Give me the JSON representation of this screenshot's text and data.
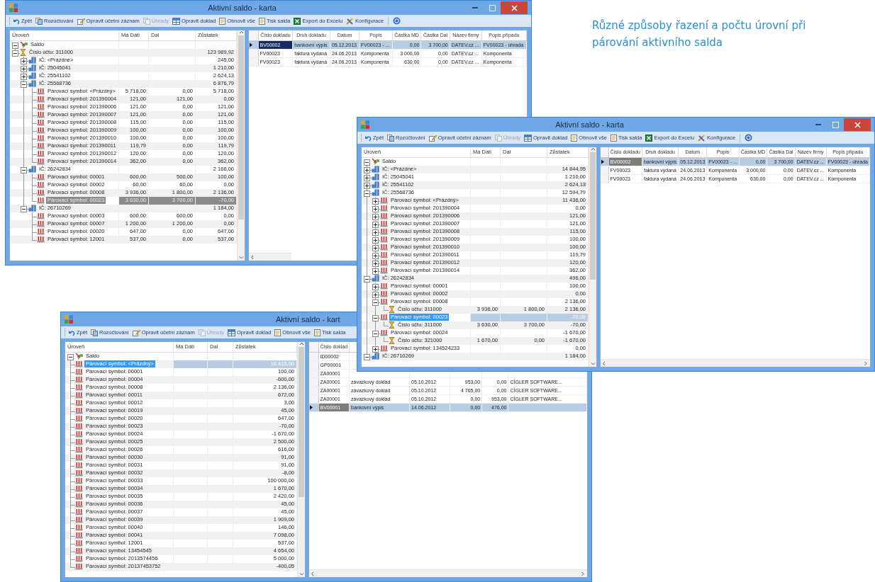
{
  "caption_lines": [
    "Různé způsoby řazení a počtu úrovní při",
    "párování aktivního salda"
  ],
  "windows": [
    {
      "title": "Aktivní saldo - karta",
      "controls": true,
      "help_button": true,
      "toolbar": [
        {
          "label": "Zpět",
          "kind": "undo",
          "disabled": false
        },
        {
          "label": "Rozúčtování",
          "kind": "documents",
          "disabled": false
        },
        {
          "label": "Opravit účetní záznam",
          "kind": "pencil",
          "disabled": false
        },
        {
          "label": "Úhrady",
          "kind": "documents",
          "disabled": true
        },
        {
          "label": "Opravit doklad",
          "kind": "table",
          "disabled": false
        },
        {
          "label": "Obnovit vše",
          "kind": "document",
          "disabled": false
        },
        {
          "label": "Tisk salda",
          "kind": "document",
          "disabled": false
        },
        {
          "label": "Export do Excelu",
          "kind": "spreadsheet",
          "disabled": false
        },
        {
          "label": "Konfigurace",
          "kind": "tools",
          "disabled": false
        }
      ],
      "tree": {
        "focused": false,
        "columns": [
          "Úroveň",
          "Má Dáti",
          "Dal",
          "Zůstatek"
        ],
        "nodes": [
          {
            "kind": "saldo",
            "label": "Saldo",
            "expanded": true,
            "selected": false,
            "children": [
              {
                "kind": "account",
                "label": "Číslo účtu: 311000",
                "balance": "123 989,92",
                "expanded": true,
                "selected": false,
                "children": [
                  {
                    "kind": "company",
                    "label": "IČ: <Prázdné>",
                    "balance": "245,00",
                    "expanded": false,
                    "selected": false
                  },
                  {
                    "kind": "company",
                    "label": "IČ: 25045041",
                    "balance": "1 210,00",
                    "expanded": false,
                    "selected": false
                  },
                  {
                    "kind": "company",
                    "label": "IČ: 25541102",
                    "balance": "2 624,13",
                    "expanded": false,
                    "selected": false
                  },
                  {
                    "kind": "company",
                    "label": "IČ: 25568736",
                    "balance": "6 876,79",
                    "expanded": true,
                    "selected": false,
                    "children": [
                      {
                        "kind": "symbol",
                        "label": "Párovací symbol: <Prázdný>",
                        "md": "5 718,00",
                        "dal": "0,00",
                        "balance": "5 718,00",
                        "selected": false
                      },
                      {
                        "kind": "symbol",
                        "label": "Párovací symbol: 201390004",
                        "md": "121,00",
                        "dal": "121,00",
                        "balance": "0,00",
                        "selected": false
                      },
                      {
                        "kind": "symbol",
                        "label": "Párovací symbol: 201390006",
                        "md": "121,00",
                        "dal": "0,00",
                        "balance": "121,00",
                        "selected": false
                      },
                      {
                        "kind": "symbol",
                        "label": "Párovací symbol: 201390007",
                        "md": "121,00",
                        "dal": "0,00",
                        "balance": "121,00",
                        "selected": false
                      },
                      {
                        "kind": "symbol",
                        "label": "Párovací symbol: 201390008",
                        "md": "115,00",
                        "dal": "0,00",
                        "balance": "115,00",
                        "selected": false
                      },
                      {
                        "kind": "symbol",
                        "label": "Párovací symbol: 201390009",
                        "md": "100,00",
                        "dal": "0,00",
                        "balance": "100,00",
                        "selected": false
                      },
                      {
                        "kind": "symbol",
                        "label": "Párovací symbol: 201390010",
                        "md": "100,00",
                        "dal": "0,00",
                        "balance": "100,00",
                        "selected": false
                      },
                      {
                        "kind": "symbol",
                        "label": "Párovací symbol: 201390011",
                        "md": "119,79",
                        "dal": "0,00",
                        "balance": "119,79",
                        "selected": false
                      },
                      {
                        "kind": "symbol",
                        "label": "Párovací symbol: 201390012",
                        "md": "120,00",
                        "dal": "0,00",
                        "balance": "120,00",
                        "selected": false
                      },
                      {
                        "kind": "symbol",
                        "label": "Párovací symbol: 201390014",
                        "md": "362,00",
                        "dal": "0,00",
                        "balance": "362,00",
                        "selected": false
                      }
                    ]
                  },
                  {
                    "kind": "company",
                    "label": "IČ: 26242834",
                    "balance": "2 166,00",
                    "expanded": true,
                    "selected": false,
                    "children": [
                      {
                        "kind": "symbol",
                        "label": "Párovací symbol: 00001",
                        "md": "600,00",
                        "dal": "500,00",
                        "balance": "100,00",
                        "selected": false
                      },
                      {
                        "kind": "symbol",
                        "label": "Párovací symbol: 00002",
                        "md": "60,00",
                        "dal": "60,00",
                        "balance": "0,00",
                        "selected": false
                      },
                      {
                        "kind": "symbol",
                        "label": "Párovací symbol: 00008",
                        "md": "3 936,00",
                        "dal": "1 800,00",
                        "balance": "2 136,00",
                        "selected": false
                      },
                      {
                        "kind": "symbol",
                        "label": "Párovací symbol: 00023",
                        "md": "3 630,00",
                        "dal": "3 700,00",
                        "balance": "-70,00",
                        "selected": true
                      }
                    ]
                  },
                  {
                    "kind": "company",
                    "label": "IČ: 26710269",
                    "balance": "1 184,00",
                    "expanded": true,
                    "selected": false,
                    "children": [
                      {
                        "kind": "symbol",
                        "label": "Párovací symbol: 00003",
                        "md": "600,00",
                        "dal": "600,00",
                        "balance": "0,00",
                        "selected": false
                      },
                      {
                        "kind": "symbol",
                        "label": "Párovací symbol: 00007",
                        "md": "1 200,00",
                        "dal": "1 200,00",
                        "balance": "0,00",
                        "selected": false
                      },
                      {
                        "kind": "symbol",
                        "label": "Párovací symbol: 00020",
                        "md": "647,00",
                        "dal": "0,00",
                        "balance": "647,00",
                        "selected": false
                      },
                      {
                        "kind": "symbol",
                        "label": "Párovací symbol: 12001",
                        "md": "537,00",
                        "dal": "0,00",
                        "balance": "537,00",
                        "selected": false
                      }
                    ]
                  }
                ]
              }
            ]
          }
        ]
      },
      "grid": {
        "focused": true,
        "columns": [
          "Číslo dokladu",
          "Druh dokladu",
          "Datum",
          "Popis",
          "Částka MD",
          "Částka Dal",
          "Název firmy",
          "Popis případu"
        ],
        "rows": [
          {
            "cells": [
              "BV00002",
              "bankovní výpis",
              "05.12.2013",
              "FV00023 - ...",
              "0,00",
              "3 700,00",
              "DATEV.cz ...",
              "FV00023 - úhrada"
            ],
            "selected": true
          },
          {
            "cells": [
              "FV00023",
              "faktura vydaná",
              "24.06.2013",
              "Komponenta",
              "3 000,00",
              "0,00",
              "DATEV.cz ...",
              "Komponenta"
            ],
            "selected": false
          },
          {
            "cells": [
              "FV00023",
              "faktura vydaná",
              "24.06.2013",
              "Komponenta",
              "630,00",
              "0,00",
              "DATEV.cz ...",
              "Komponenta"
            ],
            "selected": false
          }
        ]
      }
    },
    {
      "title": "Aktivní saldo - karta",
      "controls": true,
      "help_button": true,
      "toolbar": [
        {
          "label": "Zpět",
          "kind": "undo",
          "disabled": false
        },
        {
          "label": "Rozúčtování",
          "kind": "documents",
          "disabled": false
        },
        {
          "label": "Opravit účetní záznam",
          "kind": "pencil",
          "disabled": false
        },
        {
          "label": "Úhrady",
          "kind": "documents",
          "disabled": true
        },
        {
          "label": "Opravit doklad",
          "kind": "table",
          "disabled": false
        },
        {
          "label": "Obnovit vše",
          "kind": "document",
          "disabled": false
        },
        {
          "label": "Tisk salda",
          "kind": "document",
          "disabled": false
        },
        {
          "label": "Export do Excelu",
          "kind": "spreadsheet",
          "disabled": false
        },
        {
          "label": "Konfigurace",
          "kind": "tools",
          "disabled": false
        }
      ],
      "tree": {
        "focused": true,
        "columns": [
          "Úroveň",
          "Má Dáti",
          "Dal",
          "Zůstatek"
        ],
        "nodes": [
          {
            "kind": "saldo",
            "label": "Saldo",
            "expanded": true,
            "selected": false,
            "children": [
              {
                "kind": "company",
                "label": "IČ: <Prázdné>",
                "balance": "14 844,95",
                "expanded": false,
                "selected": false
              },
              {
                "kind": "company",
                "label": "IČ: 25045041",
                "balance": "1 210,00",
                "expanded": false,
                "selected": false
              },
              {
                "kind": "company",
                "label": "IČ: 25541102",
                "balance": "2 624,13",
                "expanded": false,
                "selected": false
              },
              {
                "kind": "company",
                "label": "IČ: 25568736",
                "balance": "12 594,79",
                "expanded": true,
                "selected": false,
                "children": [
                  {
                    "kind": "symbol",
                    "label": "Párovací symbol: <Prázdný>",
                    "balance": "11 436,00",
                    "expanded": false,
                    "selected": false
                  },
                  {
                    "kind": "symbol",
                    "label": "Párovací symbol: 201390004",
                    "balance": "0,00",
                    "expanded": false,
                    "selected": false
                  },
                  {
                    "kind": "symbol",
                    "label": "Párovací symbol: 201390006",
                    "balance": "121,00",
                    "expanded": false,
                    "selected": false
                  },
                  {
                    "kind": "symbol",
                    "label": "Párovací symbol: 201390007",
                    "balance": "121,00",
                    "expanded": false,
                    "selected": false
                  },
                  {
                    "kind": "symbol",
                    "label": "Párovací symbol: 201390008",
                    "balance": "115,00",
                    "expanded": false,
                    "selected": false
                  },
                  {
                    "kind": "symbol",
                    "label": "Párovací symbol: 201390009",
                    "balance": "100,00",
                    "expanded": false,
                    "selected": false
                  },
                  {
                    "kind": "symbol",
                    "label": "Párovací symbol: 201390010",
                    "balance": "100,00",
                    "expanded": false,
                    "selected": false
                  },
                  {
                    "kind": "symbol",
                    "label": "Párovací symbol: 201390011",
                    "balance": "119,79",
                    "expanded": false,
                    "selected": false
                  },
                  {
                    "kind": "symbol",
                    "label": "Párovací symbol: 201390012",
                    "balance": "120,00",
                    "expanded": false,
                    "selected": false
                  },
                  {
                    "kind": "symbol",
                    "label": "Párovací symbol: 201390014",
                    "balance": "362,00",
                    "expanded": false,
                    "selected": false
                  }
                ]
              },
              {
                "kind": "company",
                "label": "IČ: 26242834",
                "balance": "496,00",
                "expanded": true,
                "selected": false,
                "children": [
                  {
                    "kind": "symbol",
                    "label": "Párovací symbol: 00001",
                    "balance": "100,00",
                    "expanded": false,
                    "selected": false
                  },
                  {
                    "kind": "symbol",
                    "label": "Párovací symbol: 00002",
                    "balance": "0,00",
                    "expanded": false,
                    "selected": false
                  },
                  {
                    "kind": "symbol",
                    "label": "Párovací symbol: 00008",
                    "balance": "2 136,00",
                    "expanded": true,
                    "selected": false,
                    "children": [
                      {
                        "kind": "account",
                        "label": "Číslo účtu: 311000",
                        "md": "3 936,00",
                        "dal": "1 800,00",
                        "balance": "2 136,00",
                        "selected": false
                      }
                    ]
                  },
                  {
                    "kind": "symbol",
                    "label": "Párovací symbol: 00023",
                    "balance": "-70,00",
                    "expanded": true,
                    "selected": true,
                    "children": [
                      {
                        "kind": "account",
                        "label": "Číslo účtu: 311000",
                        "md": "3 630,00",
                        "dal": "3 700,00",
                        "balance": "-70,00",
                        "selected": false
                      }
                    ]
                  },
                  {
                    "kind": "symbol",
                    "label": "Párovací symbol: 00024",
                    "balance": "-1 670,00",
                    "expanded": true,
                    "selected": false,
                    "children": [
                      {
                        "kind": "account",
                        "label": "Číslo účtu: 321000",
                        "md": "1 670,00",
                        "dal": "0,00",
                        "balance": "-1 670,00",
                        "selected": false
                      }
                    ]
                  },
                  {
                    "kind": "symbol",
                    "label": "Párovací symbol: 134524233",
                    "balance": "0,00",
                    "expanded": false,
                    "selected": false
                  }
                ]
              },
              {
                "kind": "company",
                "label": "IČ: 26710269",
                "balance": "1 184,00",
                "expanded": true,
                "selected": false
              }
            ]
          }
        ]
      },
      "grid": {
        "focused": false,
        "columns": [
          "Číslo dokladu",
          "Druh dokladu",
          "Datum",
          "Popis",
          "Částka MD",
          "Částka Dal",
          "Název firmy",
          "Popis případu"
        ],
        "rows": [
          {
            "cells": [
              "BV00002",
              "bankovní výpis",
              "05.12.2013",
              "FV00023 - ...",
              "0,00",
              "3 700,00",
              "DATEV.cz ...",
              "FV00023 - úhrada"
            ],
            "selected": true
          },
          {
            "cells": [
              "FV00023",
              "faktura vydaná",
              "24.06.2013",
              "Komponenta",
              "3 000,00",
              "0,00",
              "DATEV.cz ...",
              "Komponenta"
            ],
            "selected": false
          },
          {
            "cells": [
              "FV00023",
              "faktura vydaná",
              "24.06.2013",
              "Komponenta",
              "630,00",
              "0,00",
              "DATEV.cz ...",
              "Komponenta"
            ],
            "selected": false
          }
        ]
      }
    },
    {
      "title": "Aktivní saldo - kart",
      "controls": false,
      "help_button": false,
      "toolbar": [
        {
          "label": "Zpět",
          "kind": "undo",
          "disabled": false
        },
        {
          "label": "Rozúčtování",
          "kind": "documents",
          "disabled": false
        },
        {
          "label": "Opravit účetní záznam",
          "kind": "pencil",
          "disabled": false
        },
        {
          "label": "Úhrady",
          "kind": "documents",
          "disabled": true
        },
        {
          "label": "Opravit doklad",
          "kind": "table",
          "disabled": false
        },
        {
          "label": "Obnovit vše",
          "kind": "document",
          "disabled": false
        },
        {
          "label": "Tisk salda",
          "kind": "document",
          "disabled": false
        }
      ],
      "tree": {
        "focused": true,
        "columns": [
          "Úroveň",
          "Má Dáti",
          "Dal",
          "Zůstatek"
        ],
        "nodes": [
          {
            "kind": "saldo",
            "label": "Saldo",
            "expanded": true,
            "selected": false,
            "children": [
              {
                "kind": "symbol",
                "label": "Párovací symbol: <Prázdný>",
                "balance": "16 415,00",
                "selected": true
              },
              {
                "kind": "symbol",
                "label": "Párovací symbol: 00001",
                "balance": "100,00",
                "selected": false
              },
              {
                "kind": "symbol",
                "label": "Párovací symbol: 00004",
                "balance": "-600,00",
                "selected": false
              },
              {
                "kind": "symbol",
                "label": "Párovací symbol: 00008",
                "balance": "2 136,00",
                "selected": false
              },
              {
                "kind": "symbol",
                "label": "Párovací symbol: 00011",
                "balance": "672,00",
                "selected": false
              },
              {
                "kind": "symbol",
                "label": "Párovací symbol: 00012",
                "balance": "3,00",
                "selected": false
              },
              {
                "kind": "symbol",
                "label": "Párovací symbol: 00019",
                "balance": "45,00",
                "selected": false
              },
              {
                "kind": "symbol",
                "label": "Párovací symbol: 00020",
                "balance": "647,00",
                "selected": false
              },
              {
                "kind": "symbol",
                "label": "Párovací symbol: 00023",
                "balance": "-70,00",
                "selected": false
              },
              {
                "kind": "symbol",
                "label": "Párovací symbol: 00024",
                "balance": "-1 670,00",
                "selected": false
              },
              {
                "kind": "symbol",
                "label": "Párovací symbol: 00025",
                "balance": "2 500,00",
                "selected": false
              },
              {
                "kind": "symbol",
                "label": "Párovací symbol: 00026",
                "balance": "616,00",
                "selected": false
              },
              {
                "kind": "symbol",
                "label": "Párovací symbol: 00030",
                "balance": "91,00",
                "selected": false
              },
              {
                "kind": "symbol",
                "label": "Párovací symbol: 00031",
                "balance": "91,00",
                "selected": false
              },
              {
                "kind": "symbol",
                "label": "Párovací symbol: 00032",
                "balance": "-8,00",
                "selected": false
              },
              {
                "kind": "symbol",
                "label": "Párovací symbol: 00033",
                "balance": "100 000,00",
                "selected": false
              },
              {
                "kind": "symbol",
                "label": "Párovací symbol: 00034",
                "balance": "1 670,00",
                "selected": false
              },
              {
                "kind": "symbol",
                "label": "Párovací symbol: 00035",
                "balance": "2 420,00",
                "selected": false
              },
              {
                "kind": "symbol",
                "label": "Párovací symbol: 00036",
                "balance": "45,00",
                "selected": false
              },
              {
                "kind": "symbol",
                "label": "Párovací symbol: 00037",
                "balance": "45,00",
                "selected": false
              },
              {
                "kind": "symbol",
                "label": "Párovací symbol: 00039",
                "balance": "1 909,00",
                "selected": false
              },
              {
                "kind": "symbol",
                "label": "Párovací symbol: 00040",
                "balance": "146,00",
                "selected": false
              },
              {
                "kind": "symbol",
                "label": "Párovací symbol: 00041",
                "balance": "7 098,00",
                "selected": false
              },
              {
                "kind": "symbol",
                "label": "Párovací symbol: 12001",
                "balance": "537,00",
                "selected": false
              },
              {
                "kind": "symbol",
                "label": "Párovací symbol: 13454545",
                "balance": "4 654,00",
                "selected": false
              },
              {
                "kind": "symbol",
                "label": "Párovací symbol: 2013574456",
                "balance": "5 000,00",
                "selected": false
              },
              {
                "kind": "symbol",
                "label": "Párovací symbol: 20137453752",
                "balance": "-400,05",
                "selected": false
              }
            ]
          }
        ]
      },
      "grid": {
        "focused": false,
        "columns": [
          "Číslo doklad"
        ],
        "rows": [
          {
            "cells": [
              "ID00002"
            ],
            "selected": false
          },
          {
            "cells": [
              "GP00001"
            ],
            "selected": false
          },
          {
            "cells": [
              "ZA00001"
            ],
            "selected": false
          },
          {
            "cells": [
              "ZA00001",
              "závazkový doklad",
              "05.10.2012",
              "953,00",
              "0,00",
              "CÍGLER SOFTWARE..."
            ],
            "selected": false
          },
          {
            "cells": [
              "ZA00001",
              "závazkový doklad",
              "05.10.2012",
              "4 765,00",
              "0,00",
              "CÍGLER SOFTWARE..."
            ],
            "selected": false
          },
          {
            "cells": [
              "ZA00001",
              "závazkový doklad",
              "05.10.2012",
              "0,00",
              "953,00",
              "CÍGLER SOFTWARE..."
            ],
            "selected": false
          },
          {
            "cells": [
              "BV00001",
              "bankovní výpis",
              "14.06.2012",
              "0,00",
              "476,00"
            ],
            "selected": true
          }
        ]
      }
    }
  ]
}
